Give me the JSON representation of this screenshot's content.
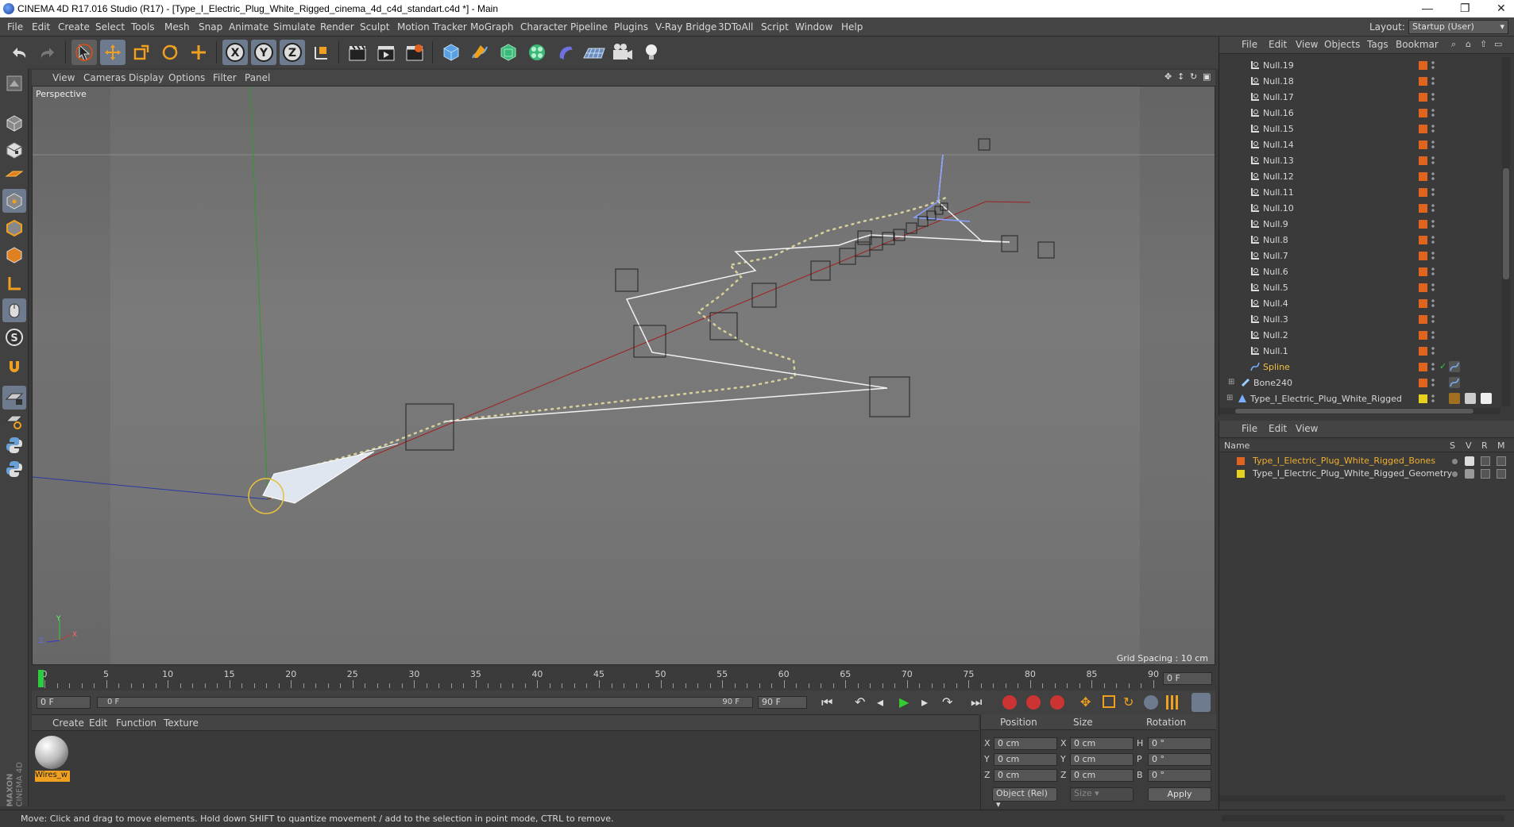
{
  "window": {
    "title": "CINEMA 4D R17.016 Studio (R17) - [Type_I_Electric_Plug_White_Rigged_cinema_4d_c4d_standart.c4d *] - Main",
    "minimize": "—",
    "restore": "❐",
    "close": "✕"
  },
  "menubar": {
    "items": [
      "File",
      "Edit",
      "Create",
      "Select",
      "Tools",
      "Mesh",
      "Snap",
      "Animate",
      "Simulate",
      "Render",
      "Sculpt",
      "Motion Tracker",
      "MoGraph",
      "Character",
      "Pipeline",
      "Plugins",
      "V-Ray Bridge",
      "3DToAll",
      "Script",
      "Window",
      "Help"
    ],
    "layout_label": "Layout:",
    "layout_value": "Startup (User)"
  },
  "viewport": {
    "menu": [
      "View",
      "Cameras",
      "Display",
      "Options",
      "Filter",
      "Panel"
    ],
    "label": "Perspective",
    "grid_spacing": "Grid Spacing : 10 cm",
    "axis_y": "Y",
    "axis_x": "X",
    "axis_z": "Z"
  },
  "timeline": {
    "ticks": [
      "0",
      "5",
      "10",
      "15",
      "20",
      "25",
      "30",
      "35",
      "40",
      "45",
      "50",
      "55",
      "60",
      "65",
      "70",
      "75",
      "80",
      "85",
      "90"
    ],
    "current_frame": "0 F"
  },
  "transport": {
    "start_field": "0 F",
    "range_start": "0 F",
    "range_end": "90 F",
    "end_field": "90 F"
  },
  "material_manager": {
    "menu": [
      "Create",
      "Edit",
      "Function",
      "Texture"
    ],
    "material_name": "Wires_w",
    "brand_top": "MAXON",
    "brand_bottom": "CINEMA 4D"
  },
  "coordinates": {
    "headers": {
      "position": "Position",
      "size": "Size",
      "rotation": "Rotation"
    },
    "rows": [
      {
        "axis": "X",
        "pos": "0 cm",
        "size_axis": "X",
        "size": "0 cm",
        "rot_axis": "H",
        "rot": "0 °"
      },
      {
        "axis": "Y",
        "pos": "0 cm",
        "size_axis": "Y",
        "size": "0 cm",
        "rot_axis": "P",
        "rot": "0 °"
      },
      {
        "axis": "Z",
        "pos": "0 cm",
        "size_axis": "Z",
        "size": "0 cm",
        "rot_axis": "B",
        "rot": "0 °"
      }
    ],
    "mode": "Object (Rel)",
    "size_mode": "Size",
    "apply": "Apply"
  },
  "object_manager": {
    "menu": [
      "File",
      "Edit",
      "View",
      "Objects",
      "Tags",
      "Bookmar"
    ],
    "objects": [
      {
        "name": "Null.19",
        "kind": "null"
      },
      {
        "name": "Null.18",
        "kind": "null"
      },
      {
        "name": "Null.17",
        "kind": "null"
      },
      {
        "name": "Null.16",
        "kind": "null"
      },
      {
        "name": "Null.15",
        "kind": "null"
      },
      {
        "name": "Null.14",
        "kind": "null"
      },
      {
        "name": "Null.13",
        "kind": "null"
      },
      {
        "name": "Null.12",
        "kind": "null"
      },
      {
        "name": "Null.11",
        "kind": "null"
      },
      {
        "name": "Null.10",
        "kind": "null"
      },
      {
        "name": "Null.9",
        "kind": "null"
      },
      {
        "name": "Null.8",
        "kind": "null"
      },
      {
        "name": "Null.7",
        "kind": "null"
      },
      {
        "name": "Null.6",
        "kind": "null"
      },
      {
        "name": "Null.5",
        "kind": "null"
      },
      {
        "name": "Null.4",
        "kind": "null"
      },
      {
        "name": "Null.3",
        "kind": "null"
      },
      {
        "name": "Null.2",
        "kind": "null"
      },
      {
        "name": "Null.1",
        "kind": "null"
      },
      {
        "name": "Spline",
        "kind": "spline"
      },
      {
        "name": "Bone240",
        "kind": "bone"
      },
      {
        "name": "Type_I_Electric_Plug_White_Rigged",
        "kind": "root"
      }
    ],
    "colors": {
      "orange": "#e0641e",
      "yellow": "#e6d21e",
      "spline_text": "#f0c040"
    }
  },
  "layer_manager": {
    "menu": [
      "File",
      "Edit",
      "View"
    ],
    "col_name": "Name",
    "cols": [
      "S",
      "V",
      "R",
      "M"
    ],
    "layers": [
      {
        "name": "Type_I_Electric_Plug_White_Rigged_Bones",
        "color": "#e0641e",
        "text_color": "#f0b030"
      },
      {
        "name": "Type_I_Electric_Plug_White_Rigged_Geometry",
        "color": "#e6d21e",
        "text_color": "#d6d6d6"
      }
    ]
  },
  "status": {
    "text": "Move: Click and drag to move elements. Hold down SHIFT to quantize movement / add to the selection in point mode, CTRL to remove."
  }
}
